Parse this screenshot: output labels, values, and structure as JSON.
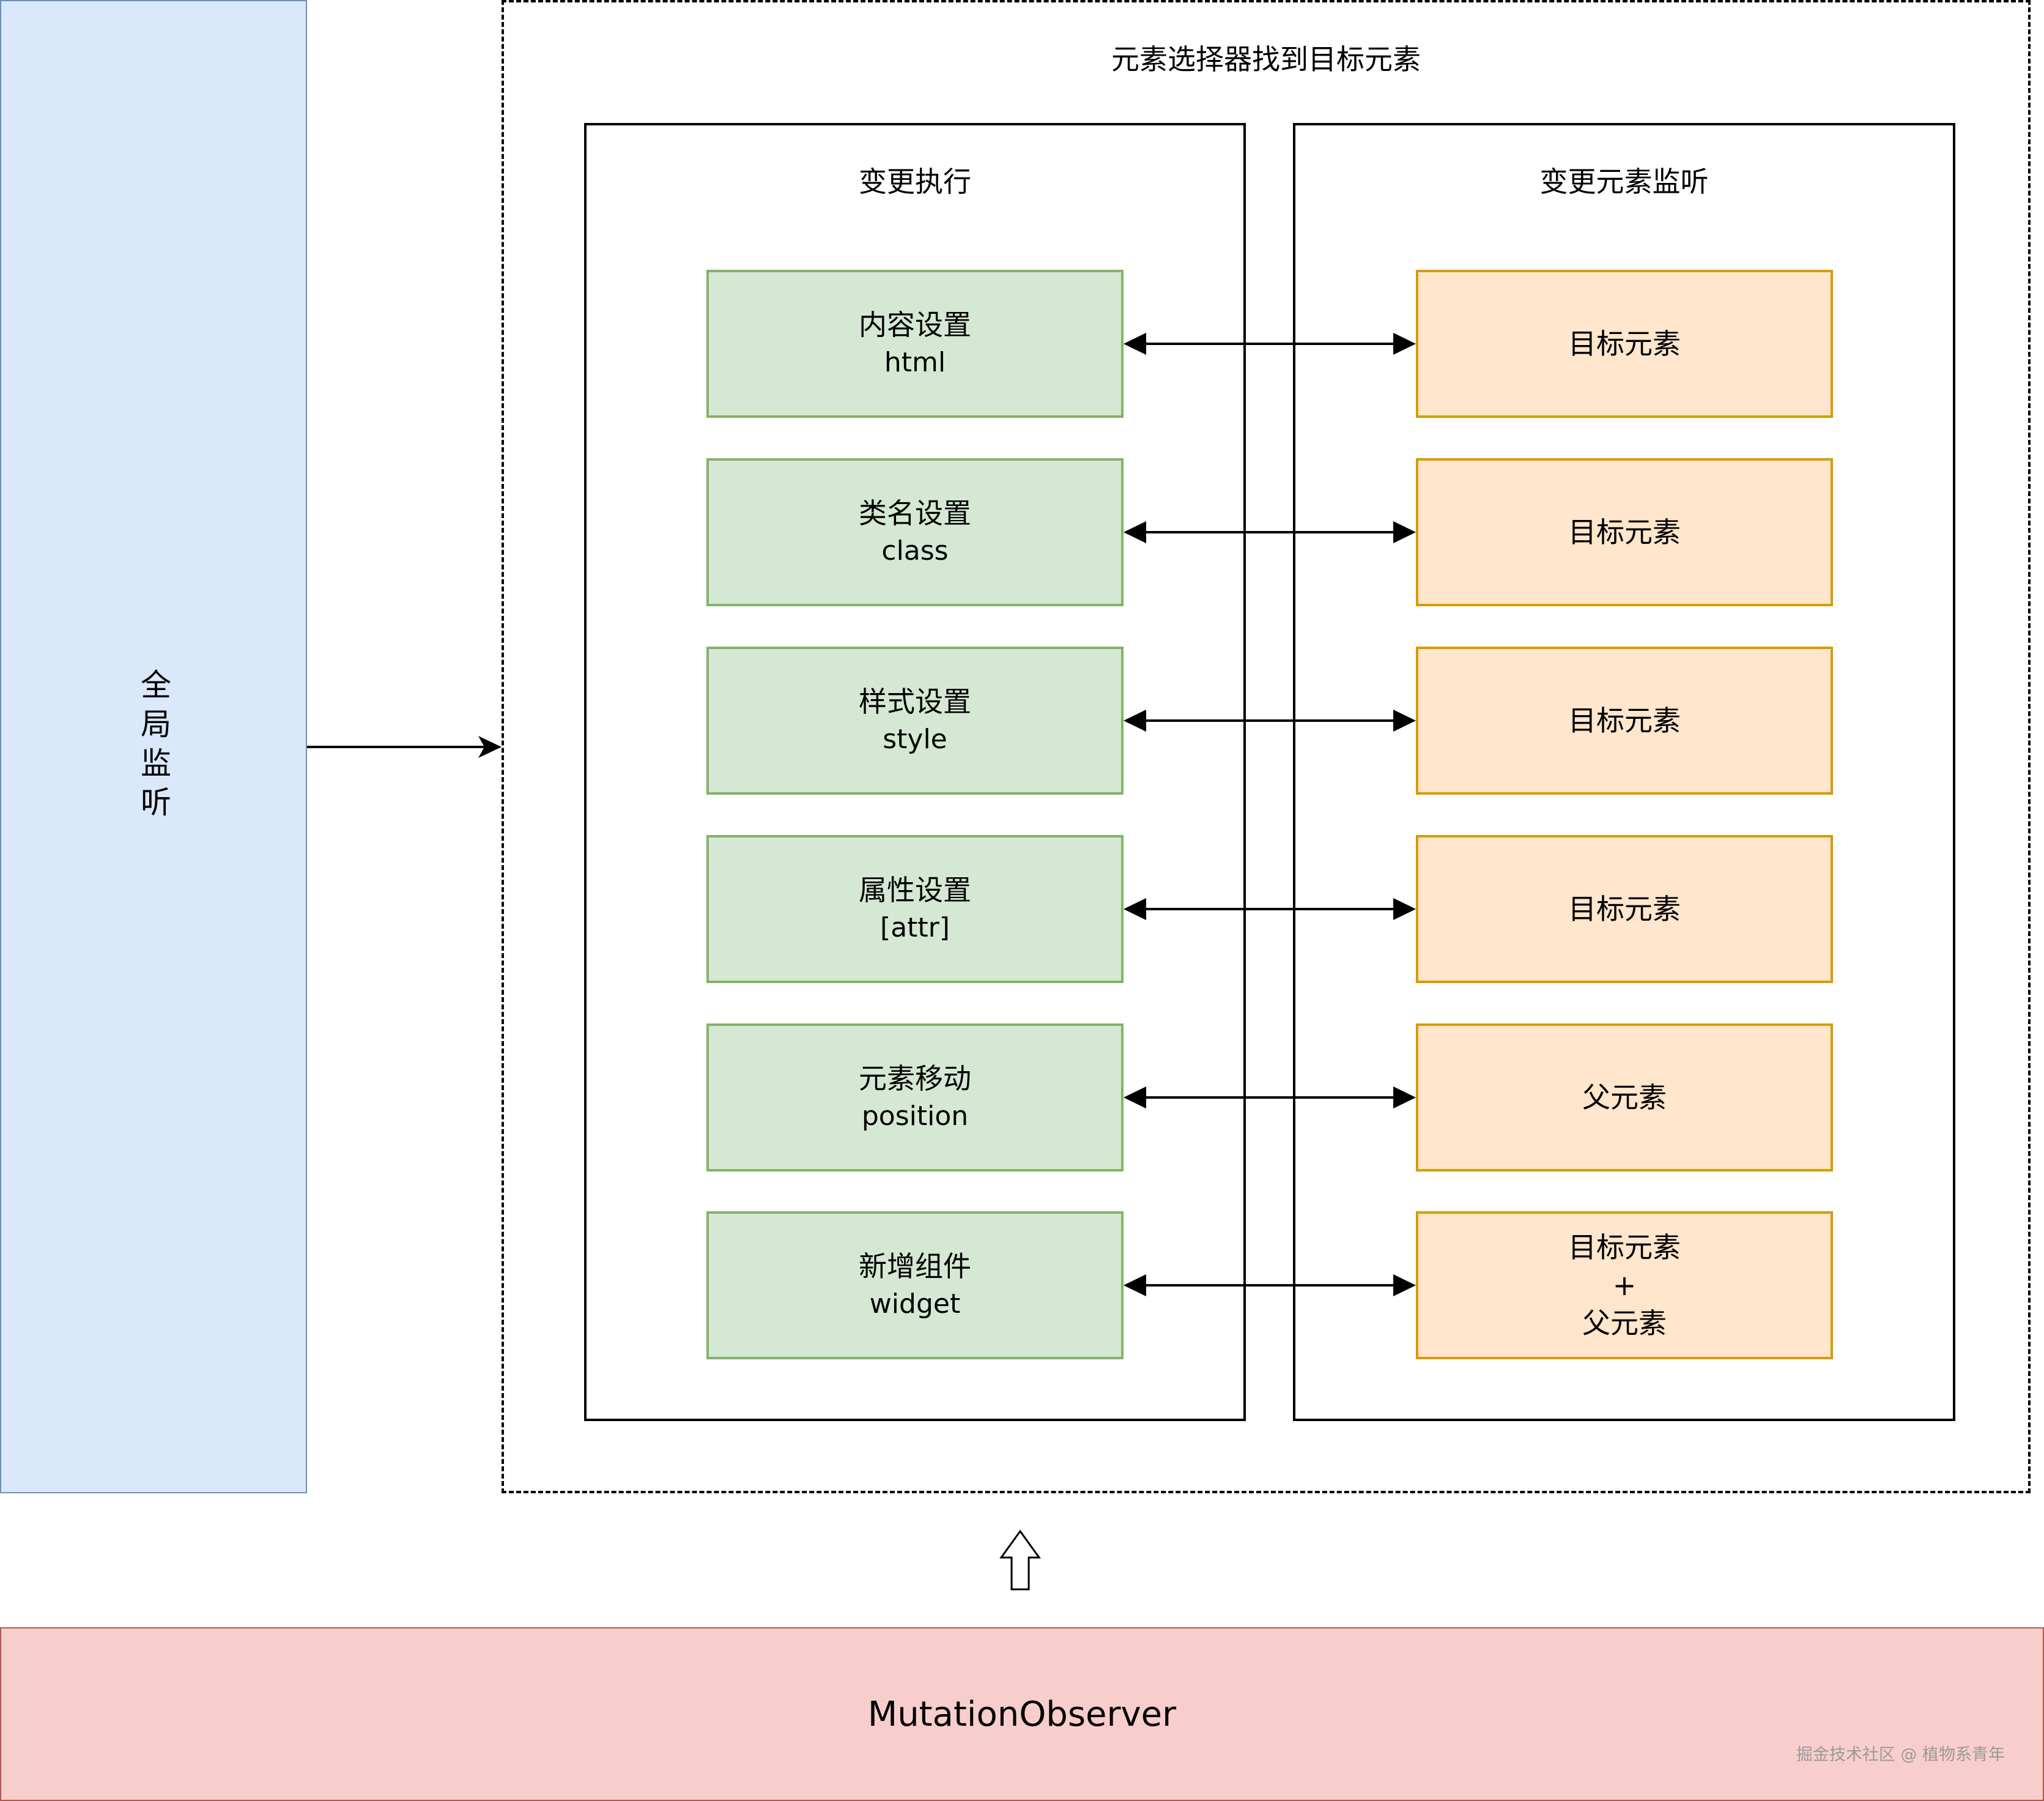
{
  "global_listener": {
    "label": "全局监听"
  },
  "selector_area": {
    "title": "元素选择器找到目标元素"
  },
  "exec_panel": {
    "title": "变更执行",
    "items": [
      {
        "label": "内容设置",
        "sub": "html"
      },
      {
        "label": "类名设置",
        "sub": "class"
      },
      {
        "label": "样式设置",
        "sub": "style"
      },
      {
        "label": "属性设置",
        "sub": "[attr]"
      },
      {
        "label": "元素移动",
        "sub": "position"
      },
      {
        "label": "新增组件",
        "sub": "widget"
      }
    ]
  },
  "watch_panel": {
    "title": "变更元素监听",
    "items": [
      {
        "lines": [
          "目标元素"
        ]
      },
      {
        "lines": [
          "目标元素"
        ]
      },
      {
        "lines": [
          "目标元素"
        ]
      },
      {
        "lines": [
          "目标元素"
        ]
      },
      {
        "lines": [
          "父元素"
        ]
      },
      {
        "lines": [
          "目标元素",
          "+",
          "父元素"
        ]
      }
    ]
  },
  "observer": {
    "label": "MutationObserver"
  },
  "watermark": {
    "text": "掘金技术社区 @ 植物系青年"
  },
  "colors": {
    "global_fill": "#dae8fc",
    "green_fill": "#d5e8d4",
    "orange_fill": "#ffe6cc",
    "observer_fill": "#f8cecc"
  }
}
